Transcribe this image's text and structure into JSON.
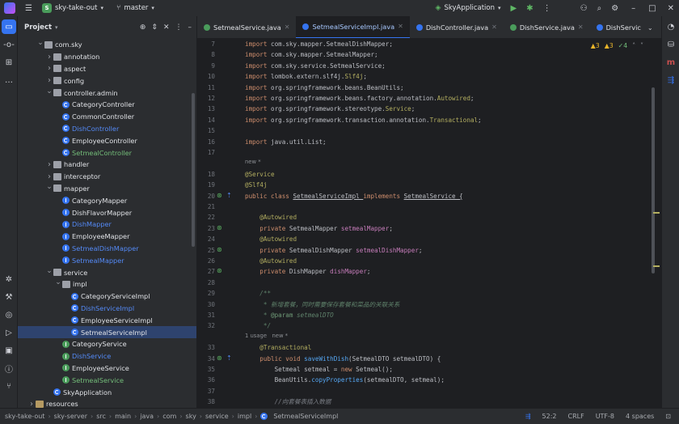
{
  "titlebar": {
    "project_badge": "S",
    "project_name": "sky-take-out",
    "branch": "master",
    "run_config": "SkyApplication"
  },
  "project_panel": {
    "title": "Project",
    "tree": [
      {
        "label": "com.sky",
        "indent": 5,
        "arrow": "v",
        "icon": "pkg",
        "color": ""
      },
      {
        "label": "annotation",
        "indent": 6,
        "arrow": ">",
        "icon": "pkg",
        "color": ""
      },
      {
        "label": "aspect",
        "indent": 6,
        "arrow": ">",
        "icon": "pkg",
        "color": ""
      },
      {
        "label": "config",
        "indent": 6,
        "arrow": ">",
        "icon": "pkg",
        "color": ""
      },
      {
        "label": "controller.admin",
        "indent": 6,
        "arrow": "v",
        "icon": "pkg",
        "color": ""
      },
      {
        "label": "CategoryController",
        "indent": 7,
        "arrow": "",
        "icon": "class",
        "color": ""
      },
      {
        "label": "CommonController",
        "indent": 7,
        "arrow": "",
        "icon": "class",
        "color": ""
      },
      {
        "label": "DishController",
        "indent": 7,
        "arrow": "",
        "icon": "class",
        "color": "blue"
      },
      {
        "label": "EmployeeController",
        "indent": 7,
        "arrow": "",
        "icon": "class",
        "color": ""
      },
      {
        "label": "SetmealController",
        "indent": 7,
        "arrow": "",
        "icon": "class",
        "color": "green"
      },
      {
        "label": "handler",
        "indent": 6,
        "arrow": ">",
        "icon": "pkg",
        "color": ""
      },
      {
        "label": "interceptor",
        "indent": 6,
        "arrow": ">",
        "icon": "pkg",
        "color": ""
      },
      {
        "label": "mapper",
        "indent": 6,
        "arrow": "v",
        "icon": "pkg",
        "color": ""
      },
      {
        "label": "CategoryMapper",
        "indent": 7,
        "arrow": "",
        "icon": "mapper",
        "color": ""
      },
      {
        "label": "DishFlavorMapper",
        "indent": 7,
        "arrow": "",
        "icon": "mapper",
        "color": ""
      },
      {
        "label": "DishMapper",
        "indent": 7,
        "arrow": "",
        "icon": "mapper",
        "color": "blue"
      },
      {
        "label": "EmployeeMapper",
        "indent": 7,
        "arrow": "",
        "icon": "mapper",
        "color": ""
      },
      {
        "label": "SetmealDishMapper",
        "indent": 7,
        "arrow": "",
        "icon": "mapper",
        "color": "blue"
      },
      {
        "label": "SetmealMapper",
        "indent": 7,
        "arrow": "",
        "icon": "mapper",
        "color": "blue"
      },
      {
        "label": "service",
        "indent": 6,
        "arrow": "v",
        "icon": "pkg",
        "color": ""
      },
      {
        "label": "impl",
        "indent": 7,
        "arrow": "v",
        "icon": "pkg",
        "color": ""
      },
      {
        "label": "CategoryServiceImpl",
        "indent": 8,
        "arrow": "",
        "icon": "class",
        "color": ""
      },
      {
        "label": "DishServiceImpl",
        "indent": 8,
        "arrow": "",
        "icon": "class",
        "color": "blue"
      },
      {
        "label": "EmployeeServiceImpl",
        "indent": 8,
        "arrow": "",
        "icon": "class",
        "color": ""
      },
      {
        "label": "SetmealServiceImpl",
        "indent": 8,
        "arrow": "",
        "icon": "class",
        "color": "",
        "selected": true
      },
      {
        "label": "CategoryService",
        "indent": 7,
        "arrow": "",
        "icon": "iface",
        "color": ""
      },
      {
        "label": "DishService",
        "indent": 7,
        "arrow": "",
        "icon": "iface",
        "color": "blue"
      },
      {
        "label": "EmployeeService",
        "indent": 7,
        "arrow": "",
        "icon": "iface",
        "color": ""
      },
      {
        "label": "SetmealService",
        "indent": 7,
        "arrow": "",
        "icon": "iface",
        "color": "green"
      },
      {
        "label": "SkyApplication",
        "indent": 6,
        "arrow": "",
        "icon": "class",
        "color": ""
      },
      {
        "label": "resources",
        "indent": 4,
        "arrow": ">",
        "icon": "folder",
        "color": ""
      }
    ]
  },
  "tabs": [
    {
      "label": "SetmealService.java",
      "icon": "iface",
      "active": false
    },
    {
      "label": "SetmealServiceImpl.java",
      "icon": "class",
      "active": true
    },
    {
      "label": "DishController.java",
      "icon": "class",
      "active": false
    },
    {
      "label": "DishService.java",
      "icon": "iface",
      "active": false
    },
    {
      "label": "DishServic",
      "icon": "class",
      "active": false
    }
  ],
  "inspections": {
    "warn1": "3",
    "warn2": "3",
    "ok": "4"
  },
  "editor": {
    "lines": [
      {
        "n": "7",
        "segs": [
          [
            "kw",
            "import "
          ],
          [
            "pt",
            "com.sky.mapper.SetmealDishMapper;"
          ]
        ]
      },
      {
        "n": "8",
        "segs": [
          [
            "kw",
            "import "
          ],
          [
            "pt",
            "com.sky.mapper.SetmealMapper;"
          ]
        ]
      },
      {
        "n": "9",
        "segs": [
          [
            "kw",
            "import "
          ],
          [
            "pt",
            "com.sky.service.SetmealService;"
          ]
        ]
      },
      {
        "n": "10",
        "segs": [
          [
            "kw",
            "import "
          ],
          [
            "pt",
            "lombok.extern.slf4j."
          ],
          [
            "ann",
            "Slf4j"
          ],
          [
            "pt",
            ";"
          ]
        ]
      },
      {
        "n": "11",
        "segs": [
          [
            "kw",
            "import "
          ],
          [
            "pt",
            "org.springframework.beans.BeanUtils;"
          ]
        ]
      },
      {
        "n": "12",
        "segs": [
          [
            "kw",
            "import "
          ],
          [
            "pt",
            "org.springframework.beans.factory.annotation."
          ],
          [
            "ann",
            "Autowired"
          ],
          [
            "pt",
            ";"
          ]
        ]
      },
      {
        "n": "13",
        "segs": [
          [
            "kw",
            "import "
          ],
          [
            "pt",
            "org.springframework.stereotype."
          ],
          [
            "ann",
            "Service"
          ],
          [
            "pt",
            ";"
          ]
        ]
      },
      {
        "n": "14",
        "segs": [
          [
            "kw",
            "import "
          ],
          [
            "pt",
            "org.springframework.transaction.annotation."
          ],
          [
            "ann",
            "Transactional"
          ],
          [
            "pt",
            ";"
          ]
        ]
      },
      {
        "n": "15",
        "segs": []
      },
      {
        "n": "16",
        "segs": [
          [
            "kw",
            "import "
          ],
          [
            "pt",
            "java.util.List;"
          ]
        ]
      },
      {
        "n": "17",
        "segs": []
      },
      {
        "inlay": "new *"
      },
      {
        "n": "18",
        "segs": [
          [
            "ann",
            "@Service"
          ]
        ]
      },
      {
        "n": "19",
        "segs": [
          [
            "ann",
            "@Slf4j"
          ]
        ]
      },
      {
        "n": "20",
        "segs": [
          [
            "kw",
            "public class "
          ],
          [
            "pt",
            "SetmealServiceImpl "
          ],
          [
            "kw",
            "implements "
          ],
          [
            "pt",
            "SetmealService {"
          ]
        ]
      },
      {
        "n": "21",
        "segs": []
      },
      {
        "n": "22",
        "segs": [
          [
            "pt",
            "    "
          ],
          [
            "ann",
            "@Autowired"
          ]
        ]
      },
      {
        "n": "23",
        "segs": [
          [
            "pt",
            "    "
          ],
          [
            "kw",
            "private "
          ],
          [
            "pt",
            "SetmealMapper "
          ],
          [
            "fld",
            "setmealMapper"
          ],
          [
            "pt",
            ";"
          ]
        ]
      },
      {
        "n": "24",
        "segs": [
          [
            "pt",
            "    "
          ],
          [
            "ann",
            "@Autowired"
          ]
        ]
      },
      {
        "n": "25",
        "segs": [
          [
            "pt",
            "    "
          ],
          [
            "kw",
            "private "
          ],
          [
            "pt",
            "SetmealDishMapper "
          ],
          [
            "fld",
            "setmealDishMapper"
          ],
          [
            "pt",
            ";"
          ]
        ]
      },
      {
        "n": "26",
        "segs": [
          [
            "pt",
            "    "
          ],
          [
            "ann",
            "@Autowired"
          ]
        ]
      },
      {
        "n": "27",
        "segs": [
          [
            "pt",
            "    "
          ],
          [
            "kw",
            "private "
          ],
          [
            "pt",
            "DishMapper "
          ],
          [
            "fld",
            "dishMapper"
          ],
          [
            "pt",
            ";"
          ]
        ]
      },
      {
        "n": "28",
        "segs": []
      },
      {
        "n": "29",
        "segs": [
          [
            "pt",
            "    "
          ],
          [
            "cmt",
            "/**"
          ]
        ]
      },
      {
        "n": "30",
        "segs": [
          [
            "pt",
            "    "
          ],
          [
            "cmt",
            " * 新增套餐，同时需要保存套餐和菜品的关联关系"
          ]
        ]
      },
      {
        "n": "31",
        "segs": [
          [
            "pt",
            "    "
          ],
          [
            "cmt",
            " * "
          ],
          [
            "tag",
            "@param "
          ],
          [
            "cmt",
            "setmealDTO"
          ]
        ]
      },
      {
        "n": "32",
        "segs": [
          [
            "pt",
            "    "
          ],
          [
            "cmt",
            " */"
          ]
        ]
      },
      {
        "inlay": "1 usage   new *"
      },
      {
        "n": "33",
        "segs": [
          [
            "pt",
            "    "
          ],
          [
            "ann",
            "@Transactional"
          ]
        ]
      },
      {
        "n": "34",
        "segs": [
          [
            "pt",
            "    "
          ],
          [
            "kw",
            "public void "
          ],
          [
            "fn",
            "saveWithDish"
          ],
          [
            "pt",
            "(SetmealDTO setmealDTO) {"
          ]
        ]
      },
      {
        "n": "35",
        "segs": [
          [
            "pt",
            "        Setmeal setmeal = "
          ],
          [
            "kw",
            "new "
          ],
          [
            "pt",
            "Setmeal();"
          ]
        ]
      },
      {
        "n": "36",
        "segs": [
          [
            "pt",
            "        BeanUtils."
          ],
          [
            "fn",
            "copyProperties"
          ],
          [
            "pt",
            "(setmealDTO, setmeal);"
          ]
        ]
      },
      {
        "n": "37",
        "segs": []
      },
      {
        "n": "38",
        "segs": [
          [
            "pt",
            "        "
          ],
          [
            "cm",
            "//向套餐表插入数据"
          ]
        ]
      }
    ]
  },
  "statusbar": {
    "crumbs": [
      "sky-take-out",
      "sky-server",
      "src",
      "main",
      "java",
      "com",
      "sky",
      "service",
      "impl",
      "SetmealServiceImpl"
    ],
    "position": "52:2",
    "line_sep": "CRLF",
    "encoding": "UTF-8",
    "indent": "4 spaces"
  }
}
